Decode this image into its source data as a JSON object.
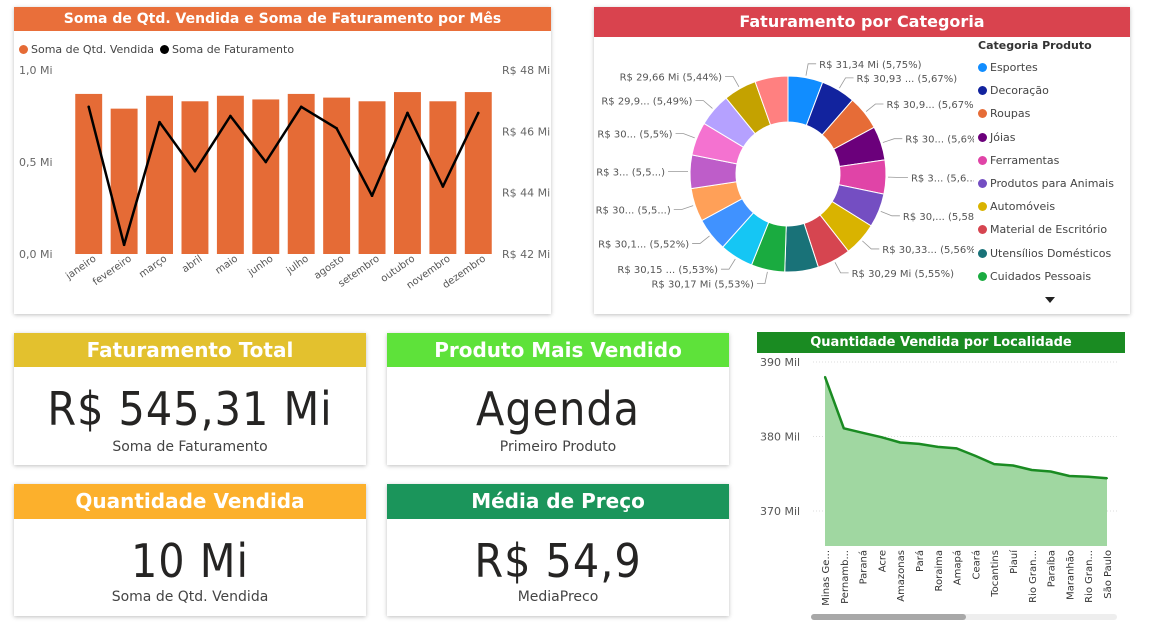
{
  "colors": {
    "orange_header": "#E96F3A",
    "red_header": "#D9434E",
    "bar": "#E56B36",
    "line": "#000000",
    "yellow_header": "#E3C12E",
    "green_header": "#5EE23A",
    "amber_header": "#FCB02C",
    "teal_header": "#1B955B",
    "area_header": "#1A8B22",
    "area_fill": "#A0D7A1",
    "area_line": "#1A8B22"
  },
  "monthly": {
    "title": "Soma de Qtd. Vendida e Soma de Faturamento por Mês",
    "legend": [
      {
        "label": "Soma de Qtd. Vendida",
        "color": "#E56B36",
        "icon": "circle"
      },
      {
        "label": "Soma de Faturamento",
        "color": "#000000",
        "icon": "circle"
      }
    ]
  },
  "category": {
    "title": "Faturamento por Categoria",
    "legend_title": "Categoria Produto",
    "legend": [
      {
        "label": "Esportes",
        "color": "#118DFF"
      },
      {
        "label": "Decoração",
        "color": "#12239E"
      },
      {
        "label": "Roupas",
        "color": "#E66C37"
      },
      {
        "label": "Jóias",
        "color": "#6B007B"
      },
      {
        "label": "Ferramentas",
        "color": "#E044A7"
      },
      {
        "label": "Produtos para Animais",
        "color": "#744EC2"
      },
      {
        "label": "Automóveis",
        "color": "#D9B300"
      },
      {
        "label": "Material de Escritório",
        "color": "#D64550"
      },
      {
        "label": "Utensílios Domésticos",
        "color": "#197278"
      },
      {
        "label": "Cuidados Pessoais",
        "color": "#1AAB40"
      }
    ],
    "more_icon": "triangle-down-icon"
  },
  "kpis": {
    "faturamento": {
      "title": "Faturamento Total",
      "value": "R$ 545,31 Mi",
      "label": "Soma de Faturamento"
    },
    "produto": {
      "title": "Produto Mais Vendido",
      "value": "Agenda",
      "label": "Primeiro Produto"
    },
    "quantidade": {
      "title": "Quantidade Vendida",
      "value": "10 Mi",
      "label": "Soma de Qtd. Vendida"
    },
    "preco": {
      "title": "Média de Preço",
      "value": "R$ 54,9",
      "label": "MediaPreco"
    }
  },
  "locality": {
    "title": "Quantidade Vendida por Localidade"
  },
  "chart_data": [
    {
      "type": "bar",
      "title": "Soma de Qtd. Vendida e Soma de Faturamento por Mês",
      "categories": [
        "janeiro",
        "fevereiro",
        "março",
        "abril",
        "maio",
        "junho",
        "julho",
        "agosto",
        "setembro",
        "outubro",
        "novembro",
        "dezembro"
      ],
      "series": [
        {
          "name": "Soma de Qtd. Vendida",
          "type": "bar",
          "axis": "left",
          "values": [
            0.87,
            0.79,
            0.86,
            0.83,
            0.86,
            0.84,
            0.87,
            0.85,
            0.83,
            0.88,
            0.83,
            0.88
          ]
        },
        {
          "name": "Soma de Faturamento",
          "type": "line",
          "axis": "right",
          "values": [
            46.8,
            42.3,
            46.3,
            44.7,
            46.5,
            45.0,
            46.8,
            46.1,
            43.9,
            46.6,
            44.2,
            46.6
          ]
        }
      ],
      "ylim": [
        0,
        1.0
      ],
      "y_ticks": [
        "0,0 Mi",
        "0,5 Mi",
        "1,0 Mi"
      ],
      "y2lim": [
        42,
        48
      ],
      "y2_ticks": [
        "R$ 42 Mi",
        "R$ 44 Mi",
        "R$ 46 Mi",
        "R$ 48 Mi"
      ],
      "legend": "top-left",
      "grid": false
    },
    {
      "type": "pie",
      "title": "Faturamento por Categoria",
      "donut": true,
      "slices": [
        {
          "label": "R$ 31,34 Mi (5,75%)",
          "value": 5.75,
          "color": "#118DFF"
        },
        {
          "label": "R$ 30,93 ... (5,67%)",
          "value": 5.67,
          "color": "#12239E"
        },
        {
          "label": "R$ 30,9... (5,67%)",
          "value": 5.67,
          "color": "#E66C37"
        },
        {
          "label": "R$ 30... (5,6%)",
          "value": 5.6,
          "color": "#6B007B"
        },
        {
          "label": "R$ 3... (5,6...)",
          "value": 5.6,
          "color": "#E044A7"
        },
        {
          "label": "R$ 30,... (5,58...)",
          "value": 5.58,
          "color": "#744EC2"
        },
        {
          "label": "R$ 30,33... (5,56%)",
          "value": 5.56,
          "color": "#D9B300"
        },
        {
          "label": "R$ 30,29 Mi (5,55%)",
          "value": 5.55,
          "color": "#D64550"
        },
        {
          "label": "",
          "value": 5.54,
          "color": "#197278"
        },
        {
          "label": "R$ 30,17 Mi (5,53%)",
          "value": 5.53,
          "color": "#1AAB40"
        },
        {
          "label": "R$ 30,15 ... (5,53%)",
          "value": 5.53,
          "color": "#15C6F4"
        },
        {
          "label": "R$ 30,1... (5,52%)",
          "value": 5.52,
          "color": "#4092FF"
        },
        {
          "label": "R$ 30... (5,5...)",
          "value": 5.5,
          "color": "#FFA058"
        },
        {
          "label": "R$ 3... (5,5...)",
          "value": 5.5,
          "color": "#BE5DC9"
        },
        {
          "label": "R$ 30... (5,5%)",
          "value": 5.5,
          "color": "#F472D0"
        },
        {
          "label": "R$ 29,9... (5,49%)",
          "value": 5.49,
          "color": "#B5A1FF"
        },
        {
          "label": "R$ 29,66 Mi (5,44%)",
          "value": 5.44,
          "color": "#C4A200"
        },
        {
          "label": "",
          "value": 5.44,
          "color": "#FF8080"
        }
      ]
    },
    {
      "type": "area",
      "title": "Quantidade Vendida por Localidade",
      "categories": [
        "Minas Ge...",
        "Pernamb...",
        "Paraná",
        "Acre",
        "Amazonas",
        "Pará",
        "Roraima",
        "Amapá",
        "Ceará",
        "Tocantins",
        "Piauí",
        "Rio Gran...",
        "Paraíba",
        "Maranhão",
        "Rio Gran...",
        "São Paulo"
      ],
      "values": [
        388.0,
        381.1,
        380.5,
        379.9,
        379.2,
        379.0,
        378.6,
        378.4,
        377.4,
        376.3,
        376.1,
        375.5,
        375.3,
        374.7,
        374.6,
        374.4
      ],
      "ylim": [
        365.3,
        390.0
      ],
      "y_ticks": [
        "370 Mil",
        "380 Mil",
        "390 Mil"
      ],
      "grid": true
    }
  ]
}
